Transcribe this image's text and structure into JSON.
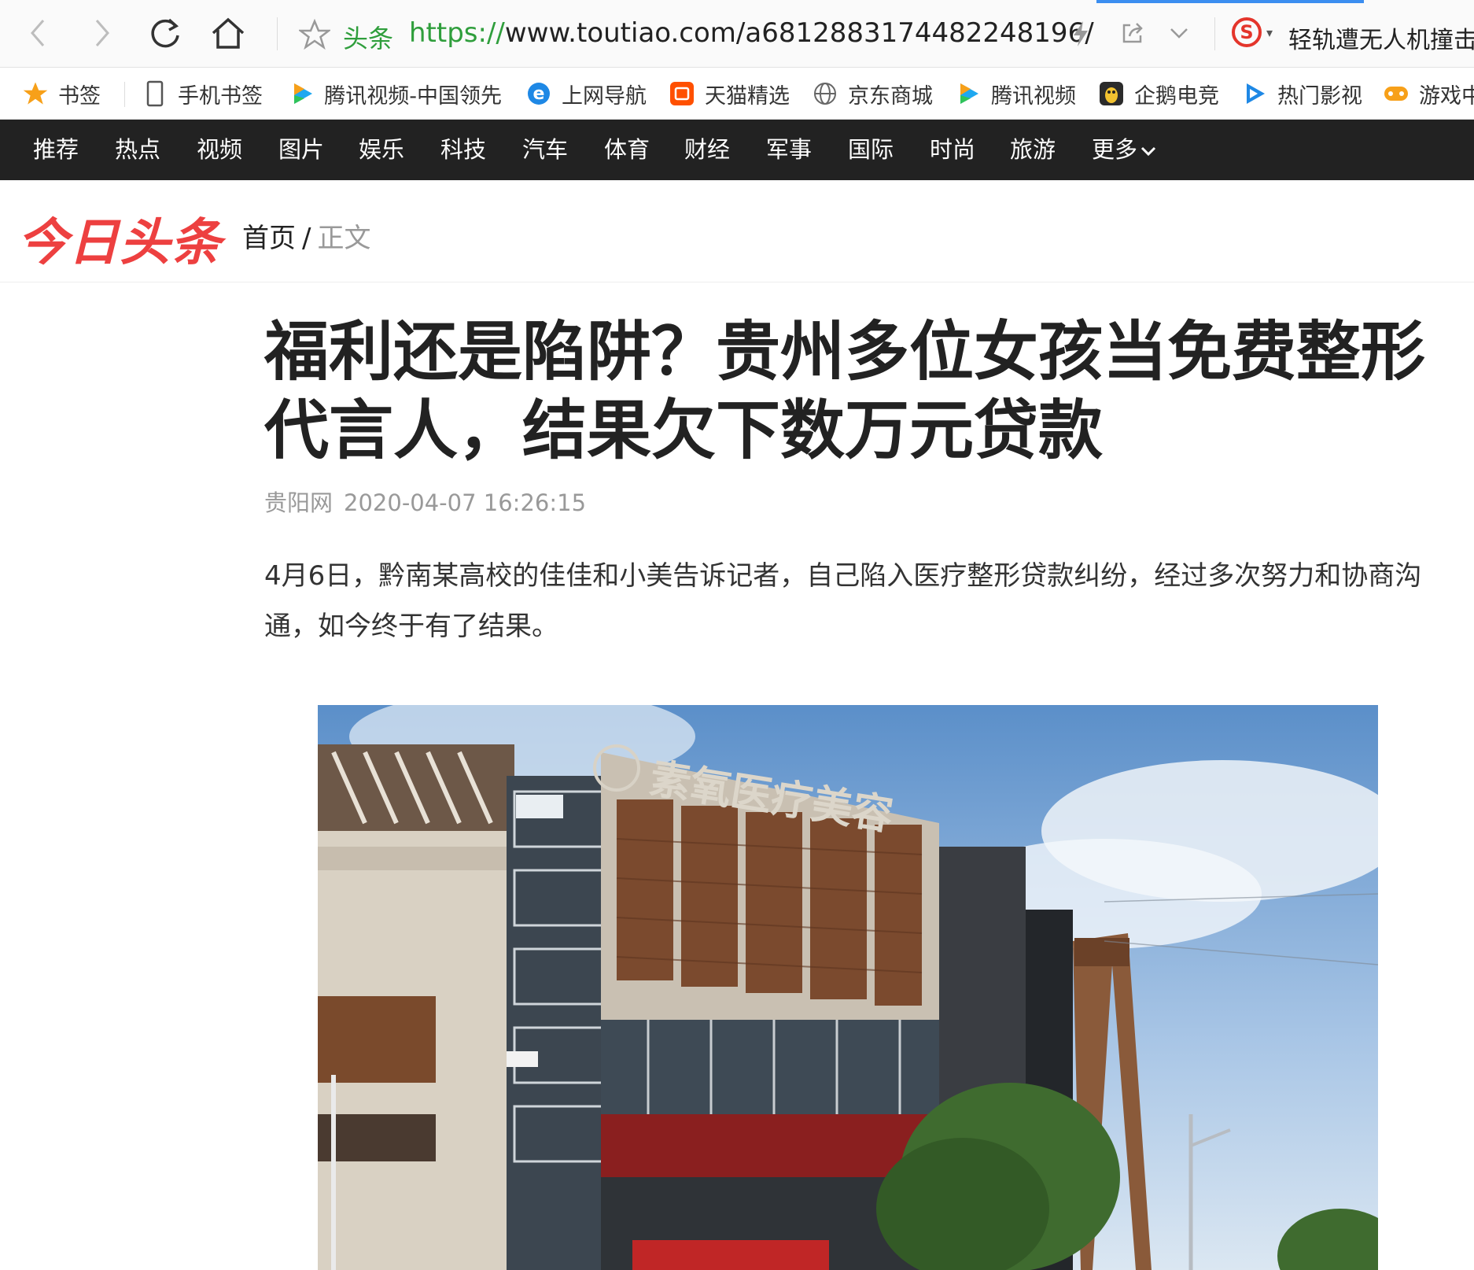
{
  "browser": {
    "site_label": "头条",
    "url_scheme": "https://",
    "url_rest": "www.toutiao.com/a6812883174482248196/",
    "search_engine_glyph": "S",
    "search_text": "轻轨遭无人机撞击",
    "icons": [
      "back-icon",
      "forward-icon",
      "reload-icon",
      "home-icon",
      "star-icon",
      "lightning-icon",
      "share-icon",
      "chevron-down-icon",
      "search-engine-icon"
    ]
  },
  "bookmarks": [
    {
      "label": "书签",
      "icon": "star-icon"
    },
    {
      "label": "手机书签",
      "icon": "phone-icon"
    },
    {
      "label": "腾讯视频-中国领先",
      "icon": "play-icon"
    },
    {
      "label": "上网导航",
      "icon": "ie-icon"
    },
    {
      "label": "天猫精选",
      "icon": "taobao-icon"
    },
    {
      "label": "京东商城",
      "icon": "globe-icon"
    },
    {
      "label": "腾讯视频",
      "icon": "play-icon"
    },
    {
      "label": "企鹅电竞",
      "icon": "penguin-icon"
    },
    {
      "label": "热门影视",
      "icon": "play-icon"
    },
    {
      "label": "游戏中",
      "icon": "gamepad-icon"
    }
  ],
  "channels": [
    "推荐",
    "热点",
    "视频",
    "图片",
    "娱乐",
    "科技",
    "汽车",
    "体育",
    "财经",
    "军事",
    "国际",
    "时尚",
    "旅游",
    "更多"
  ],
  "site": {
    "logo": "今日头条",
    "breadcrumb_home": "首页",
    "breadcrumb_sep": "/",
    "breadcrumb_current": "正文"
  },
  "article": {
    "title": "福利还是陷阱？贵州多位女孩当免费整形代言人，结果欠下数万元贷款",
    "source": "贵阳网",
    "time": "2020-04-07 16:26:15",
    "paragraph": "4月6日，黔南某高校的佳佳和小美告诉记者，自己陷入医疗整形贷款纠纷，经过多次努力和协商沟通，如今终于有了结果。",
    "photo_sign": "素氧医疗美容"
  },
  "colors": {
    "brand_red": "#ed4040",
    "nav_bg": "#222222",
    "url_green": "#2f9e3c",
    "accent_blue": "#3b8ef0"
  }
}
